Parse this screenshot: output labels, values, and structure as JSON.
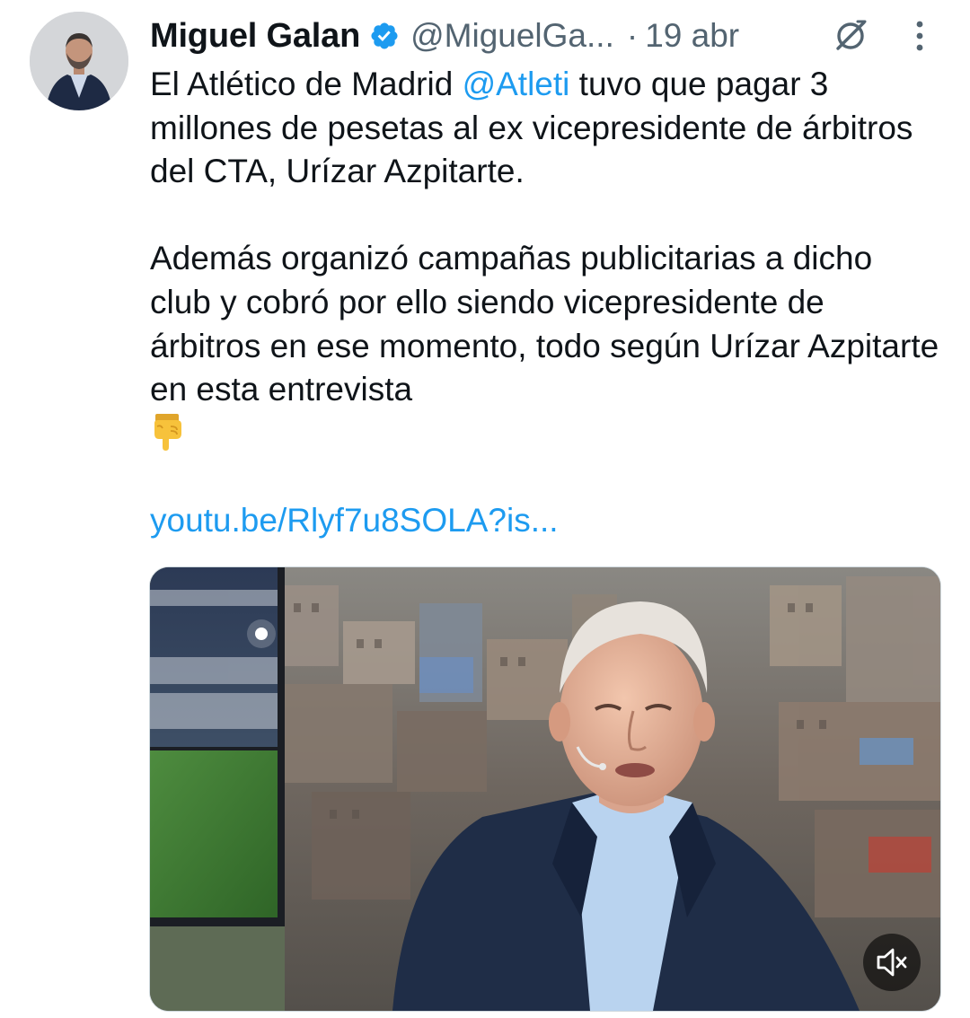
{
  "tweet": {
    "display_name": "Miguel Galan",
    "handle": "@MiguelGa...",
    "separator": "·",
    "time": "19 abr",
    "body": {
      "p1_pre": "El Atlético de Madrid ",
      "p1_mention": "@Atleti",
      "p1_post": " tuvo que pagar 3 millones de pesetas al ex vicepresidente de árbitros del CTA, Urízar Azpitarte.",
      "p2": "Además organizó campañas publicitarias a dicho club y cobró por ello siendo vicepresidente de árbitros en ese momento, todo según Urízar Azpitarte en esta entrevista",
      "emoji": "backhand-index-pointing-down",
      "link": "youtu.be/Rlyf7u8SOLA?is..."
    },
    "icons": {
      "verified": "verified-badge-icon",
      "grok": "grok-icon",
      "more": "more-vertical-icon",
      "mute": "volume-muted-icon"
    },
    "colors": {
      "link": "#1d9bf0",
      "text": "#0f1419",
      "secondary": "#536471"
    }
  }
}
